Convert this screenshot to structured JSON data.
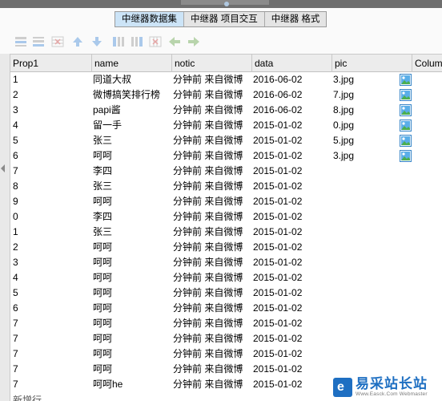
{
  "tabs": [
    "中继器数据集",
    "中继器 项目交互",
    "中继器 格式"
  ],
  "active_tab": 0,
  "toolbar": {
    "icons": [
      "add-row-above-icon",
      "add-row-below-icon",
      "delete-row-icon",
      "move-up-icon",
      "move-down-icon",
      "add-column-left-icon",
      "add-column-right-icon",
      "delete-column-icon",
      "move-left-icon",
      "move-right-icon"
    ]
  },
  "columns": [
    "Prop1",
    "name",
    "notic",
    "data",
    "pic",
    "Colum"
  ],
  "rows": [
    {
      "prop1": "1",
      "name": "同道大叔",
      "notic": "分钟前 来自微博",
      "data": "2016-06-02",
      "pic": "3.jpg",
      "has_image": true
    },
    {
      "prop1": "2",
      "name": "微博搞笑排行榜",
      "notic": "分钟前 来自微博",
      "data": "2016-06-02",
      "pic": "7.jpg",
      "has_image": true
    },
    {
      "prop1": "3",
      "name": "papi酱",
      "notic": "分钟前 来自微博",
      "data": "2016-06-02",
      "pic": "8.jpg",
      "has_image": true
    },
    {
      "prop1": "4",
      "name": "留一手",
      "notic": "分钟前 来自微博",
      "data": "2015-01-02",
      "pic": "0.jpg",
      "has_image": true
    },
    {
      "prop1": "5",
      "name": "张三",
      "notic": "分钟前 来自微博",
      "data": "2015-01-02",
      "pic": "5.jpg",
      "has_image": true
    },
    {
      "prop1": "6",
      "name": "呵呵",
      "notic": "分钟前 来自微博",
      "data": "2015-01-02",
      "pic": "3.jpg",
      "has_image": true
    },
    {
      "prop1": "7",
      "name": "李四",
      "notic": "分钟前 来自微博",
      "data": "2015-01-02",
      "pic": "",
      "has_image": false
    },
    {
      "prop1": "8",
      "name": "张三",
      "notic": "分钟前 来自微博",
      "data": "2015-01-02",
      "pic": "",
      "has_image": false
    },
    {
      "prop1": "9",
      "name": "呵呵",
      "notic": "分钟前 来自微博",
      "data": "2015-01-02",
      "pic": "",
      "has_image": false
    },
    {
      "prop1": "0",
      "name": "李四",
      "notic": "分钟前 来自微博",
      "data": "2015-01-02",
      "pic": "",
      "has_image": false
    },
    {
      "prop1": "1",
      "name": "张三",
      "notic": "分钟前 来自微博",
      "data": "2015-01-02",
      "pic": "",
      "has_image": false
    },
    {
      "prop1": "2",
      "name": "呵呵",
      "notic": "分钟前 来自微博",
      "data": "2015-01-02",
      "pic": "",
      "has_image": false
    },
    {
      "prop1": "3",
      "name": "呵呵",
      "notic": "分钟前 来自微博",
      "data": "2015-01-02",
      "pic": "",
      "has_image": false
    },
    {
      "prop1": "4",
      "name": "呵呵",
      "notic": "分钟前 来自微博",
      "data": "2015-01-02",
      "pic": "",
      "has_image": false
    },
    {
      "prop1": "5",
      "name": "呵呵",
      "notic": "分钟前 来自微博",
      "data": "2015-01-02",
      "pic": "",
      "has_image": false
    },
    {
      "prop1": "6",
      "name": "呵呵",
      "notic": "分钟前 来自微博",
      "data": "2015-01-02",
      "pic": "",
      "has_image": false
    },
    {
      "prop1": "7",
      "name": "呵呵",
      "notic": "分钟前 来自微博",
      "data": "2015-01-02",
      "pic": "",
      "has_image": false
    },
    {
      "prop1": "7",
      "name": "呵呵",
      "notic": "分钟前 来自微博",
      "data": "2015-01-02",
      "pic": "",
      "has_image": false
    },
    {
      "prop1": "7",
      "name": "呵呵",
      "notic": "分钟前 来自微博",
      "data": "2015-01-02",
      "pic": "",
      "has_image": false
    },
    {
      "prop1": "7",
      "name": "呵呵",
      "notic": "分钟前 来自微博",
      "data": "2015-01-02",
      "pic": "",
      "has_image": false
    },
    {
      "prop1": "7",
      "name": "呵呵he",
      "notic": "分钟前 来自微博",
      "data": "2015-01-02",
      "pic": "",
      "has_image": false
    }
  ],
  "new_row_label": "新增行",
  "watermark": {
    "brand": "易采站长站",
    "sub": "Www.Easck.Com Webmaster"
  },
  "colors": {
    "active_tab": "#cce4f7",
    "toolbar_icon_blue": "#4a90d9",
    "toolbar_icon_green": "#6aa84f",
    "watermark_blue": "#1e6fc2"
  }
}
